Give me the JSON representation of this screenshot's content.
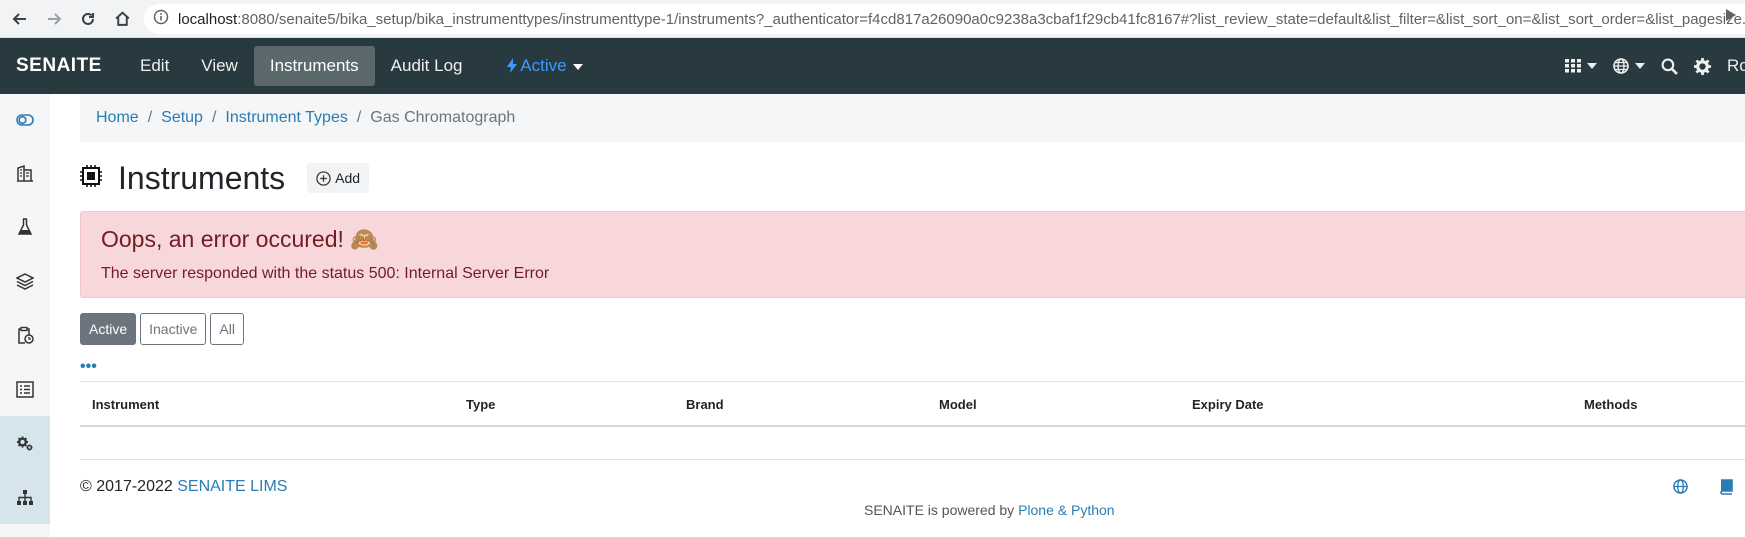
{
  "browser": {
    "host": "localhost",
    "url_rest": ":8080/senaite5/bika_setup/bika_instrumenttypes/instrumenttype-1/instruments?_authenticator=f4cd817a26090a0c9238a3cbaf1f29cb41fc8167#?list_review_state=default&list_filter=&list_sort_on=&list_sort_order=&list_pagesize..."
  },
  "navbar": {
    "brand": "SENAITE",
    "items": [
      "Edit",
      "View",
      "Instruments",
      "Audit Log"
    ],
    "state": "Active",
    "user_initial": "Ro"
  },
  "breadcrumb": {
    "home": "Home",
    "setup": "Setup",
    "instrument_types": "Instrument Types",
    "current": "Gas Chromatograph"
  },
  "page": {
    "title": "Instruments",
    "add_label": "Add"
  },
  "alert": {
    "title": "Oops, an error occured! 🙈",
    "message": "The server responded with the status 500: Internal Server Error"
  },
  "filters": {
    "active": "Active",
    "inactive": "Inactive",
    "all": "All"
  },
  "table": {
    "more": "•••",
    "columns": [
      "Instrument",
      "Type",
      "Brand",
      "Model",
      "Expiry Date",
      "Methods"
    ]
  },
  "footer": {
    "copyright": "2017-2022",
    "lims_link": "SENAITE LIMS",
    "powered_prefix": "SENAITE is powered by",
    "powered_link": "Plone & Python"
  },
  "colors": {
    "navbar": "#283a3f",
    "link": "#2a7db3",
    "alert_bg": "#f8d7da",
    "alert_text": "#721c24",
    "state_accent": "#3d9bff"
  }
}
